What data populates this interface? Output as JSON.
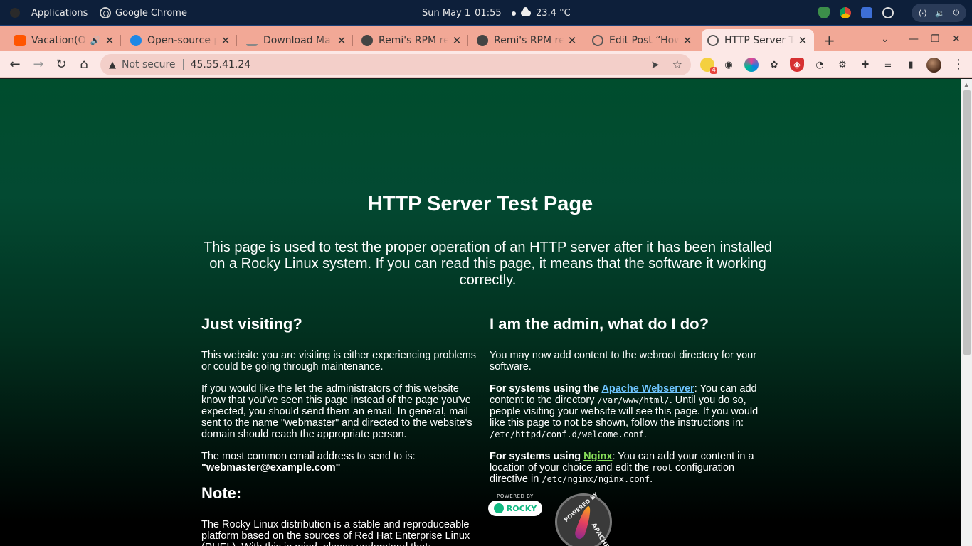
{
  "system_bar": {
    "apps_label": "Applications",
    "active_app": "Google Chrome",
    "date": "Sun May 1",
    "time": "01:55",
    "temperature": "23.4 °C"
  },
  "tabs": [
    {
      "title": "Vacation(O",
      "favicon_color": "#ff5500",
      "audio": "🔊"
    },
    {
      "title": "Open-source p",
      "favicon_color": "#1e88e5"
    },
    {
      "title": "Download Ma",
      "favicon_color": "#888888"
    },
    {
      "title": "Remi's RPM re",
      "favicon_color": "#444444"
    },
    {
      "title": "Remi's RPM re",
      "favicon_color": "#444444"
    },
    {
      "title": "Edit Post “How",
      "favicon_color": "#555555"
    },
    {
      "title": "HTTP Server Te",
      "favicon_color": "#555555",
      "active": true
    }
  ],
  "omnibox": {
    "security_label": "Not secure",
    "url": "45.55.41.24"
  },
  "extensions": {
    "badge_count": "4"
  },
  "page": {
    "title": "HTTP Server Test Page",
    "intro": "This page is used to test the proper operation of an HTTP server after it has been installed on a Rocky Linux system. If you can read this page, it means that the software it working correctly.",
    "left": {
      "heading": "Just visiting?",
      "p1": "This website you are visiting is either experiencing problems or could be going through maintenance.",
      "p2": "If you would like the let the administrators of this website know that you've seen this page instead of the page you've expected, you should send them an email. In general, mail sent to the name \"webmaster\" and directed to the website's domain should reach the appropriate person.",
      "p3_text": "The most common email address to send to is:",
      "p3_email": "\"webmaster@example.com\"",
      "note_heading": "Note:",
      "note_text": "The Rocky Linux distribution is a stable and reproduceable platform based on the sources of Red Hat Enterprise Linux (RHEL). With this in mind, please understand that:"
    },
    "right": {
      "heading": "I am the admin, what do I do?",
      "p1": "You may now add content to the webroot directory for your software.",
      "apache_prefix": "For systems using the ",
      "apache_link": "Apache Webserver",
      "apache_text1": ": You can add content to the directory ",
      "apache_code1": "/var/www/html/",
      "apache_text2": ". Until you do so, people visiting your website will see this page. If you would like this page to not be shown, follow the instructions in: ",
      "apache_code2": "/etc/httpd/conf.d/welcome.conf",
      "apache_end": ".",
      "nginx_prefix": "For systems using ",
      "nginx_link": "Nginx",
      "nginx_text1": ": You can add your content in a location of your choice and edit the ",
      "nginx_code1": "root",
      "nginx_text2": " configuration directive in ",
      "nginx_code2": "/etc/nginx/nginx.conf",
      "nginx_end": "."
    },
    "badges": {
      "rocky_powered": "POWERED BY",
      "rocky_name": "ROCKY",
      "apache_top": "POWERED BY",
      "apache_bottom": "APACHE"
    }
  },
  "colors": {
    "tabstrip": "#f2a896",
    "toolbar": "#fce8e6",
    "page_top": "#004d2d",
    "page_bottom": "#000000",
    "apache_link": "#6ec5ff",
    "nginx_link": "#88e05a"
  }
}
